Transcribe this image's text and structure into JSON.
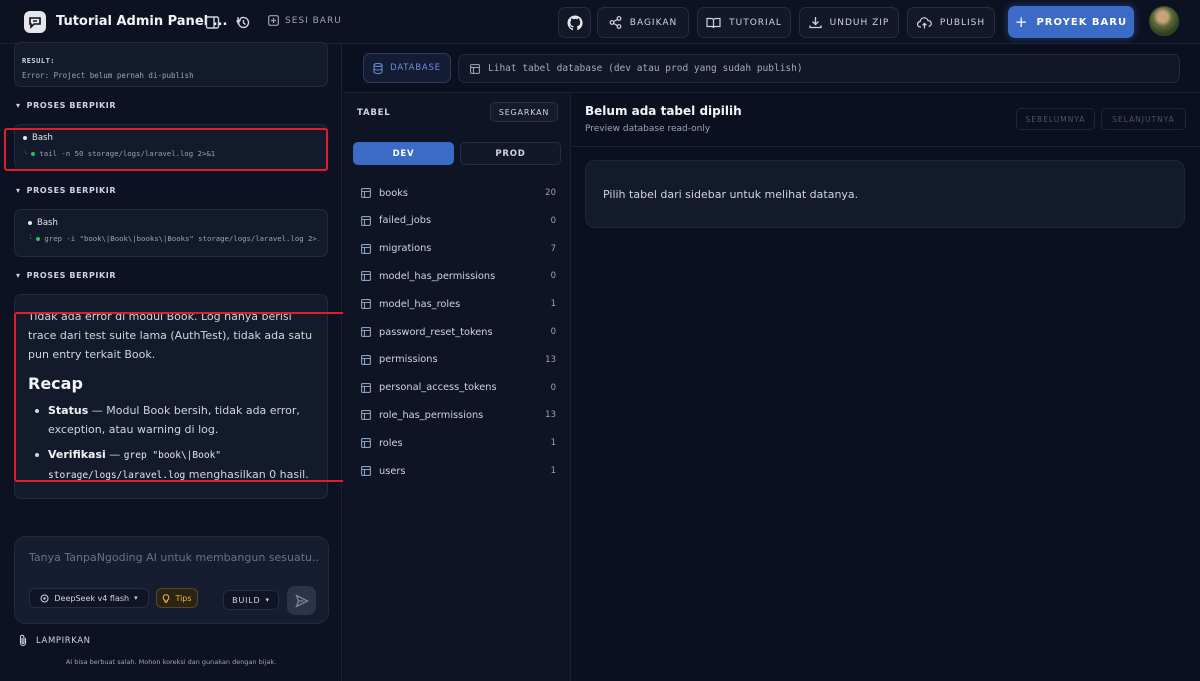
{
  "topbar": {
    "app_title": "Tutorial Admin Panel ...",
    "sesi_label": "SESI BARU",
    "share_label": "BAGIKAN",
    "tutorial_label": "TUTORIAL",
    "download_label": "UNDUH ZIP",
    "publish_label": "PUBLISH",
    "new_project_label": "PROYEK BARU"
  },
  "chat": {
    "result_label": "RESULT:",
    "result_text": "Error: Project belum pernah di-publish",
    "thinking_label": "PROSES BERPIKIR",
    "tool_1": {
      "name": "Bash",
      "command": "tail -n 50 storage/logs/laravel.log 2>&1"
    },
    "tool_2": {
      "name": "Bash",
      "command": "grep -i \"book\\|Book\\|books\\|Books\" storage/logs/laravel.log 2>..."
    },
    "message": {
      "intro": "Tidak ada error di modul Book. Log hanya berisi trace dari test suite lama (AuthTest), tidak ada satu pun entry terkait Book.",
      "recap_heading": "Recap",
      "bullet_1_bold": "Status",
      "bullet_1_text": " — Modul Book bersih, tidak ada error, exception, atau warning di log.",
      "bullet_2_bold": "Verifikasi",
      "bullet_2_dash": " — ",
      "bullet_2_code": "grep \"book\\|Book\" storage/logs/laravel.log",
      "bullet_2_text": " menghasilkan 0 hasil."
    },
    "composer": {
      "placeholder": "Tanya TanpaNgoding AI untuk membangun sesuatu...",
      "model": "DeepSeek v4 flash",
      "tips": "Tips",
      "mode": "BUILD"
    },
    "attach_label": "LAMPIRKAN",
    "disclaimer": "AI bisa berbuat salah. Mohon koreksi dan gunakan dengan bijak."
  },
  "database": {
    "tab_label": "DATABASE",
    "hint": "Lihat tabel database (dev atau prod yang sudah publish)",
    "tables_label": "TABEL",
    "refresh_label": "SEGARKAN",
    "env_dev": "DEV",
    "env_prod": "PROD",
    "tables": [
      {
        "name": "books",
        "count": "20"
      },
      {
        "name": "failed_jobs",
        "count": "0"
      },
      {
        "name": "migrations",
        "count": "7"
      },
      {
        "name": "model_has_permissions",
        "count": "0"
      },
      {
        "name": "model_has_roles",
        "count": "1"
      },
      {
        "name": "password_reset_tokens",
        "count": "0"
      },
      {
        "name": "permissions",
        "count": "13"
      },
      {
        "name": "personal_access_tokens",
        "count": "0"
      },
      {
        "name": "role_has_permissions",
        "count": "13"
      },
      {
        "name": "roles",
        "count": "1"
      },
      {
        "name": "users",
        "count": "1"
      }
    ],
    "viewer_title": "Belum ada tabel dipilih",
    "viewer_subtitle": "Preview database read-only",
    "prev_label": "SEBELUMNYA",
    "next_label": "SELANJUTNYA",
    "empty_message": "Pilih tabel dari sidebar untuk melihat datanya."
  },
  "colors": {
    "accent": "#3b6bc7",
    "highlight": "#e11d2a",
    "tips": "#f5b83d",
    "status_ok": "#22c55e"
  }
}
